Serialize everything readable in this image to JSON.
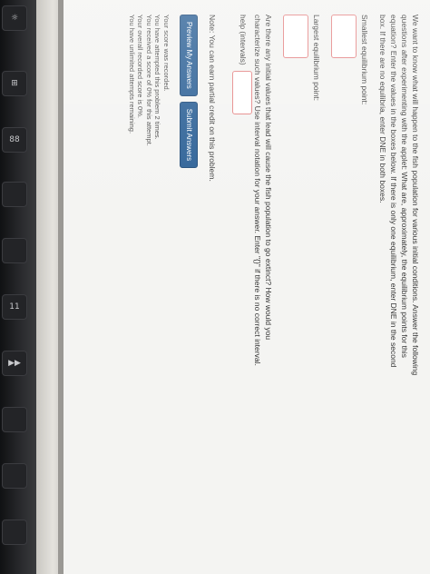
{
  "keyboard": {
    "keys": [
      "☼",
      "⊞",
      "88",
      "",
      "",
      "",
      "",
      "",
      "",
      "",
      "",
      "11",
      "▶▶",
      "",
      "",
      "",
      "",
      ""
    ]
  },
  "problem": {
    "intro": "We want to know what will happen to the fish population for various initial conditions. Answer the following questions after experimenting with the applet: What are, approximately, the equilibrium points for this equation? Enter the values in the boxes below. If there is only one equilibrium, enter DNE in the second box. If there are no equilibria, enter DNE in both boxes.",
    "smallest_label": "Smallest equilibrium point:",
    "largest_label": "Largest equilibrium point:",
    "extinct_question": "Are there any initial values that lead will cause the fish population to go extinct? How would you characterize such values? Use interval notation for your answer. Enter \"{}\" if there is no correct interval. help (intervals)",
    "note": "Note: You can earn partial credit on this problem."
  },
  "buttons": {
    "preview": "Preview My Answers",
    "submit": "Submit Answers"
  },
  "status": {
    "line1": "Your score was recorded.",
    "line2": "You have attempted this problem 2 times.",
    "line3": "You received a score of 0% for this attempt.",
    "line4": "Your overall recorded score is 0%.",
    "line5": "You have unlimited attempts remaining."
  }
}
